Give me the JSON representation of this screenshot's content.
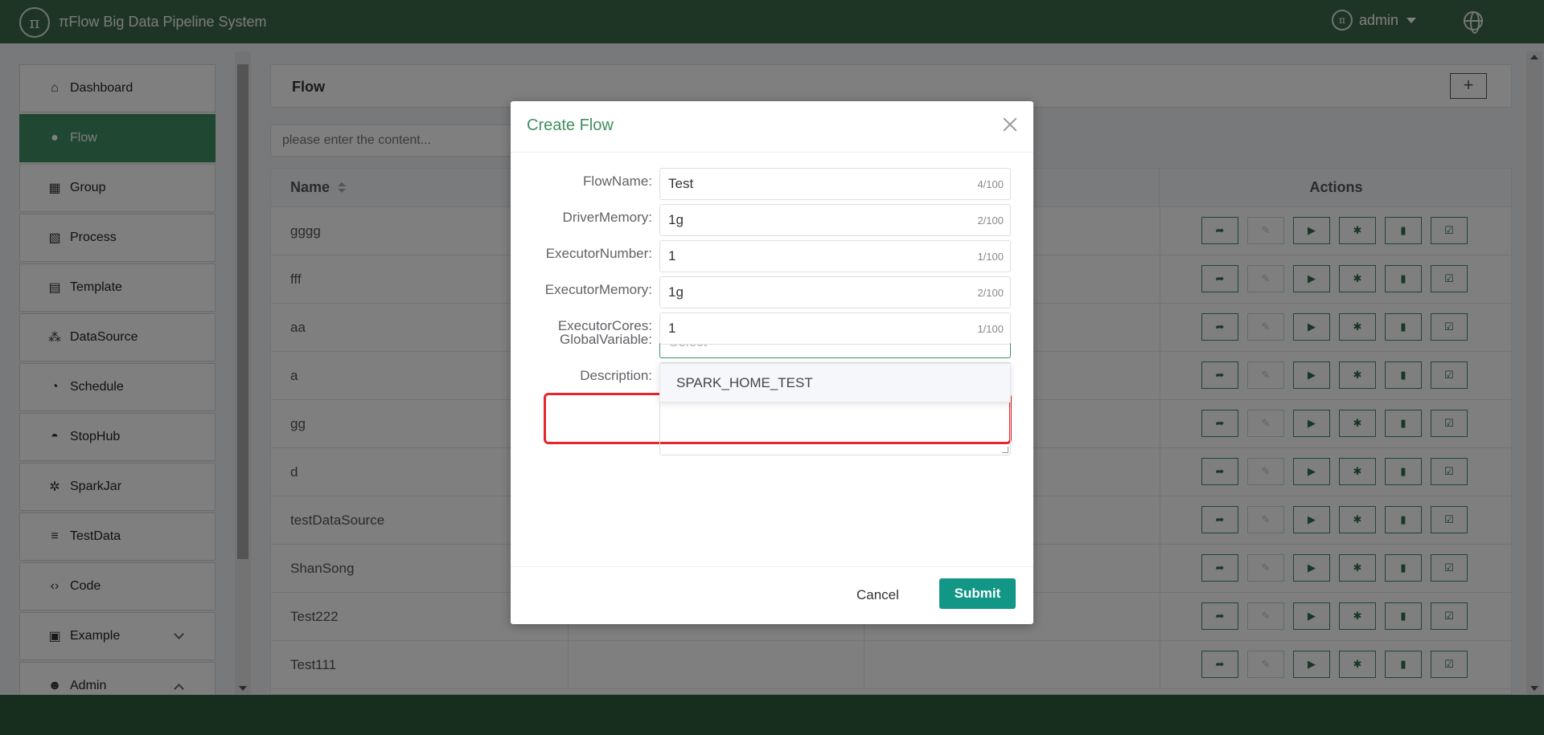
{
  "header": {
    "logo_text": "π",
    "title": "πFlow Big Data Pipeline System",
    "user": "admin"
  },
  "sidebar": {
    "items": [
      {
        "label": "Dashboard",
        "icon": "home-icon",
        "glyph": "⌂"
      },
      {
        "label": "Flow",
        "icon": "flow-icon",
        "glyph": "●",
        "active": true
      },
      {
        "label": "Group",
        "icon": "grid-icon",
        "glyph": "▦"
      },
      {
        "label": "Process",
        "icon": "chart-line-icon",
        "glyph": "▧"
      },
      {
        "label": "Template",
        "icon": "document-icon",
        "glyph": "▤"
      },
      {
        "label": "DataSource",
        "icon": "cubes-icon",
        "glyph": "⁂"
      },
      {
        "label": "Schedule",
        "icon": "clock-icon",
        "glyph": "◔"
      },
      {
        "label": "StopHub",
        "icon": "dashboard-icon",
        "glyph": "◓"
      },
      {
        "label": "SparkJar",
        "icon": "gear-icon",
        "glyph": "✲"
      },
      {
        "label": "TestData",
        "icon": "list-icon",
        "glyph": "≡"
      },
      {
        "label": "Code",
        "icon": "code-icon",
        "glyph": "‹›"
      },
      {
        "label": "Example",
        "icon": "box-icon",
        "glyph": "▣",
        "arrow": "down"
      },
      {
        "label": "Admin",
        "icon": "users-icon",
        "glyph": "☻",
        "arrow": "up"
      }
    ]
  },
  "panel": {
    "title": "Flow",
    "add_label": "+",
    "search_placeholder": "please enter the content...",
    "columns": {
      "name": "Name",
      "actions": "Actions"
    },
    "rows": [
      "gggg",
      "fff",
      "aa",
      "a",
      "gg",
      "d",
      "testDataSource",
      "ShanSong",
      "Test222",
      "Test111"
    ],
    "action_icons": [
      {
        "name": "share-icon",
        "glyph": "➦"
      },
      {
        "name": "edit-icon",
        "glyph": "✎",
        "disabled": true
      },
      {
        "name": "play-icon",
        "glyph": "▶"
      },
      {
        "name": "bug-icon",
        "glyph": "✱"
      },
      {
        "name": "trash-icon",
        "glyph": "▮"
      },
      {
        "name": "check-square-icon",
        "glyph": "☑"
      }
    ]
  },
  "modal": {
    "title": "Create Flow",
    "fields": [
      {
        "label": "FlowName:",
        "value": "Test",
        "count": "4/100"
      },
      {
        "label": "DriverMemory:",
        "value": "1g",
        "count": "2/100"
      },
      {
        "label": "ExecutorNumber:",
        "value": "1",
        "count": "1/100"
      },
      {
        "label": "ExecutorMemory:",
        "value": "1g",
        "count": "2/100"
      },
      {
        "label": "ExecutorCores:",
        "value": "1",
        "count": "1/100"
      }
    ],
    "global_variable": {
      "label": "GlobalVariable:",
      "placeholder": "Select",
      "options": [
        "SPARK_HOME_TEST"
      ]
    },
    "description_label": "Description:",
    "cancel_label": "Cancel",
    "submit_label": "Submit"
  }
}
